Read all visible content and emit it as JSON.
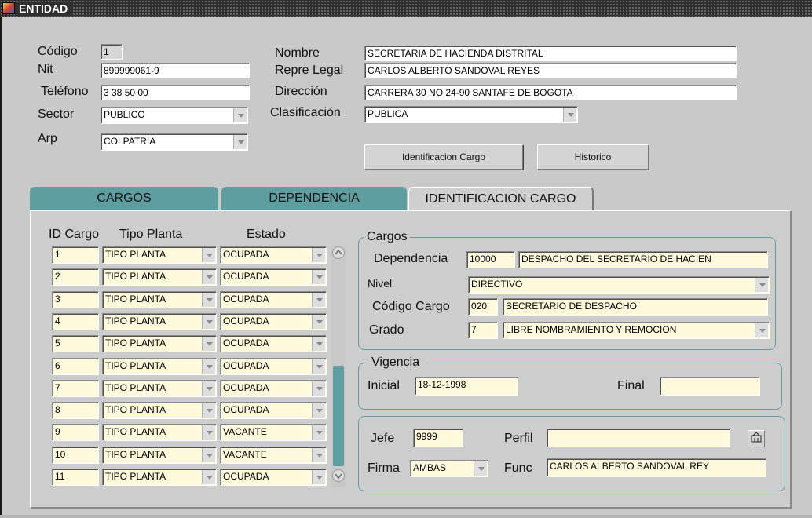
{
  "window": {
    "title": "ENTIDAD"
  },
  "entidad": {
    "codigo": {
      "label": "Código",
      "value": "1"
    },
    "nit": {
      "label": "Nit",
      "value": "899999061-9"
    },
    "telefono": {
      "label": "Teléfono",
      "value": "3 38 50 00"
    },
    "sector": {
      "label": "Sector",
      "value": "PUBLICO"
    },
    "arp": {
      "label": "Arp",
      "value": "COLPATRIA"
    },
    "nombre": {
      "label": "Nombre",
      "value": "SECRETARIA DE HACIENDA DISTRITAL"
    },
    "repre_legal": {
      "label": "Repre Legal",
      "value": "CARLOS ALBERTO SANDOVAL REYES"
    },
    "direccion": {
      "label": "Dirección",
      "value": "CARRERA 30 NO 24-90 SANTAFE DE BOGOTA"
    },
    "clasificacion": {
      "label": "Clasificación",
      "value": "PUBLICA"
    }
  },
  "buttons": {
    "identificacion_cargo": "Identificacion Cargo",
    "historico": "Historico"
  },
  "tabs": [
    {
      "label": "CARGOS"
    },
    {
      "label": "DEPENDENCIA"
    },
    {
      "label": "IDENTIFICACION CARGO"
    }
  ],
  "table": {
    "headers": {
      "id": "ID Cargo",
      "tipo": "Tipo Planta",
      "estado": "Estado"
    },
    "rows": [
      {
        "id": "1",
        "tipo": "TIPO PLANTA",
        "estado": "OCUPADA"
      },
      {
        "id": "2",
        "tipo": "TIPO PLANTA",
        "estado": "OCUPADA"
      },
      {
        "id": "3",
        "tipo": "TIPO PLANTA",
        "estado": "OCUPADA"
      },
      {
        "id": "4",
        "tipo": "TIPO PLANTA",
        "estado": "OCUPADA"
      },
      {
        "id": "5",
        "tipo": "TIPO PLANTA",
        "estado": "OCUPADA"
      },
      {
        "id": "6",
        "tipo": "TIPO PLANTA",
        "estado": "OCUPADA"
      },
      {
        "id": "7",
        "tipo": "TIPO PLANTA",
        "estado": "OCUPADA"
      },
      {
        "id": "8",
        "tipo": "TIPO PLANTA",
        "estado": "OCUPADA"
      },
      {
        "id": "9",
        "tipo": "TIPO PLANTA",
        "estado": "VACANTE"
      },
      {
        "id": "10",
        "tipo": "TIPO PLANTA",
        "estado": "VACANTE"
      },
      {
        "id": "11",
        "tipo": "TIPO PLANTA",
        "estado": "OCUPADA"
      }
    ]
  },
  "cargos": {
    "legend": "Cargos",
    "dependencia": {
      "label": "Dependencia",
      "code": "10000",
      "name": "DESPACHO DEL SECRETARIO DE HACIEN"
    },
    "nivel": {
      "label": "Nivel",
      "value": "DIRECTIVO"
    },
    "codigo_cargo": {
      "label": "Código Cargo",
      "code": "020",
      "name": "SECRETARIO DE DESPACHO"
    },
    "grado": {
      "label": "Grado",
      "value": "7",
      "tipo": "LIBRE NOMBRAMIENTO Y REMOCION"
    }
  },
  "vigencia": {
    "legend": "Vigencia",
    "inicial": {
      "label": "Inicial",
      "value": "18-12-1998"
    },
    "final": {
      "label": "Final",
      "value": ""
    }
  },
  "otros": {
    "jefe": {
      "label": "Jefe",
      "value": "9999"
    },
    "perfil": {
      "label": "Perfil",
      "value": ""
    },
    "firma": {
      "label": "Firma",
      "value": "AMBAS"
    },
    "func": {
      "label": "Func",
      "value": "CARLOS ALBERTO SANDOVAL REY"
    }
  },
  "colors": {
    "tab_teal": "#5f9ea0",
    "field_yellow": "#fffadc",
    "background": "#c9c9c9"
  },
  "icons": {
    "app": "forms-app-icon",
    "lov": "list-of-values-icon"
  }
}
